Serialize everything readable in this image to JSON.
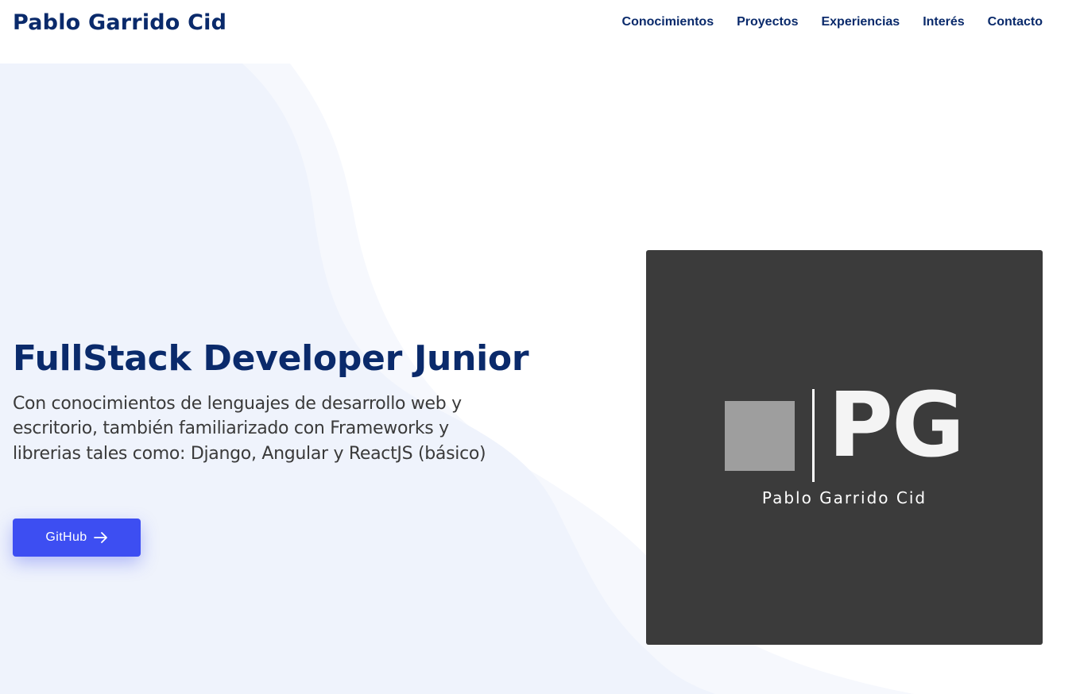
{
  "header": {
    "brand": "Pablo Garrido Cid",
    "nav": [
      {
        "label": "Conocimientos"
      },
      {
        "label": "Proyectos"
      },
      {
        "label": "Experiencias"
      },
      {
        "label": "Interés"
      },
      {
        "label": "Contacto"
      }
    ]
  },
  "hero": {
    "title": "FullStack Developer Junior",
    "subtitle": "Con conocimientos de lenguajes de desarrollo web y escritorio, también familiarizado con Frameworks y librerias tales como: Django, Angular y ReactJS (básico)",
    "button_label": "GitHub",
    "button_icon": "arrow-right-icon"
  },
  "logo": {
    "initials": "PG",
    "name": "Pablo Garrido Cid"
  },
  "colors": {
    "brand": "#0a2a6b",
    "accent": "#3d4ef2",
    "hero_wave": "#eff3fc",
    "hero_wave_light": "#f6f8fd",
    "logo_bg": "#3b3b3b"
  }
}
